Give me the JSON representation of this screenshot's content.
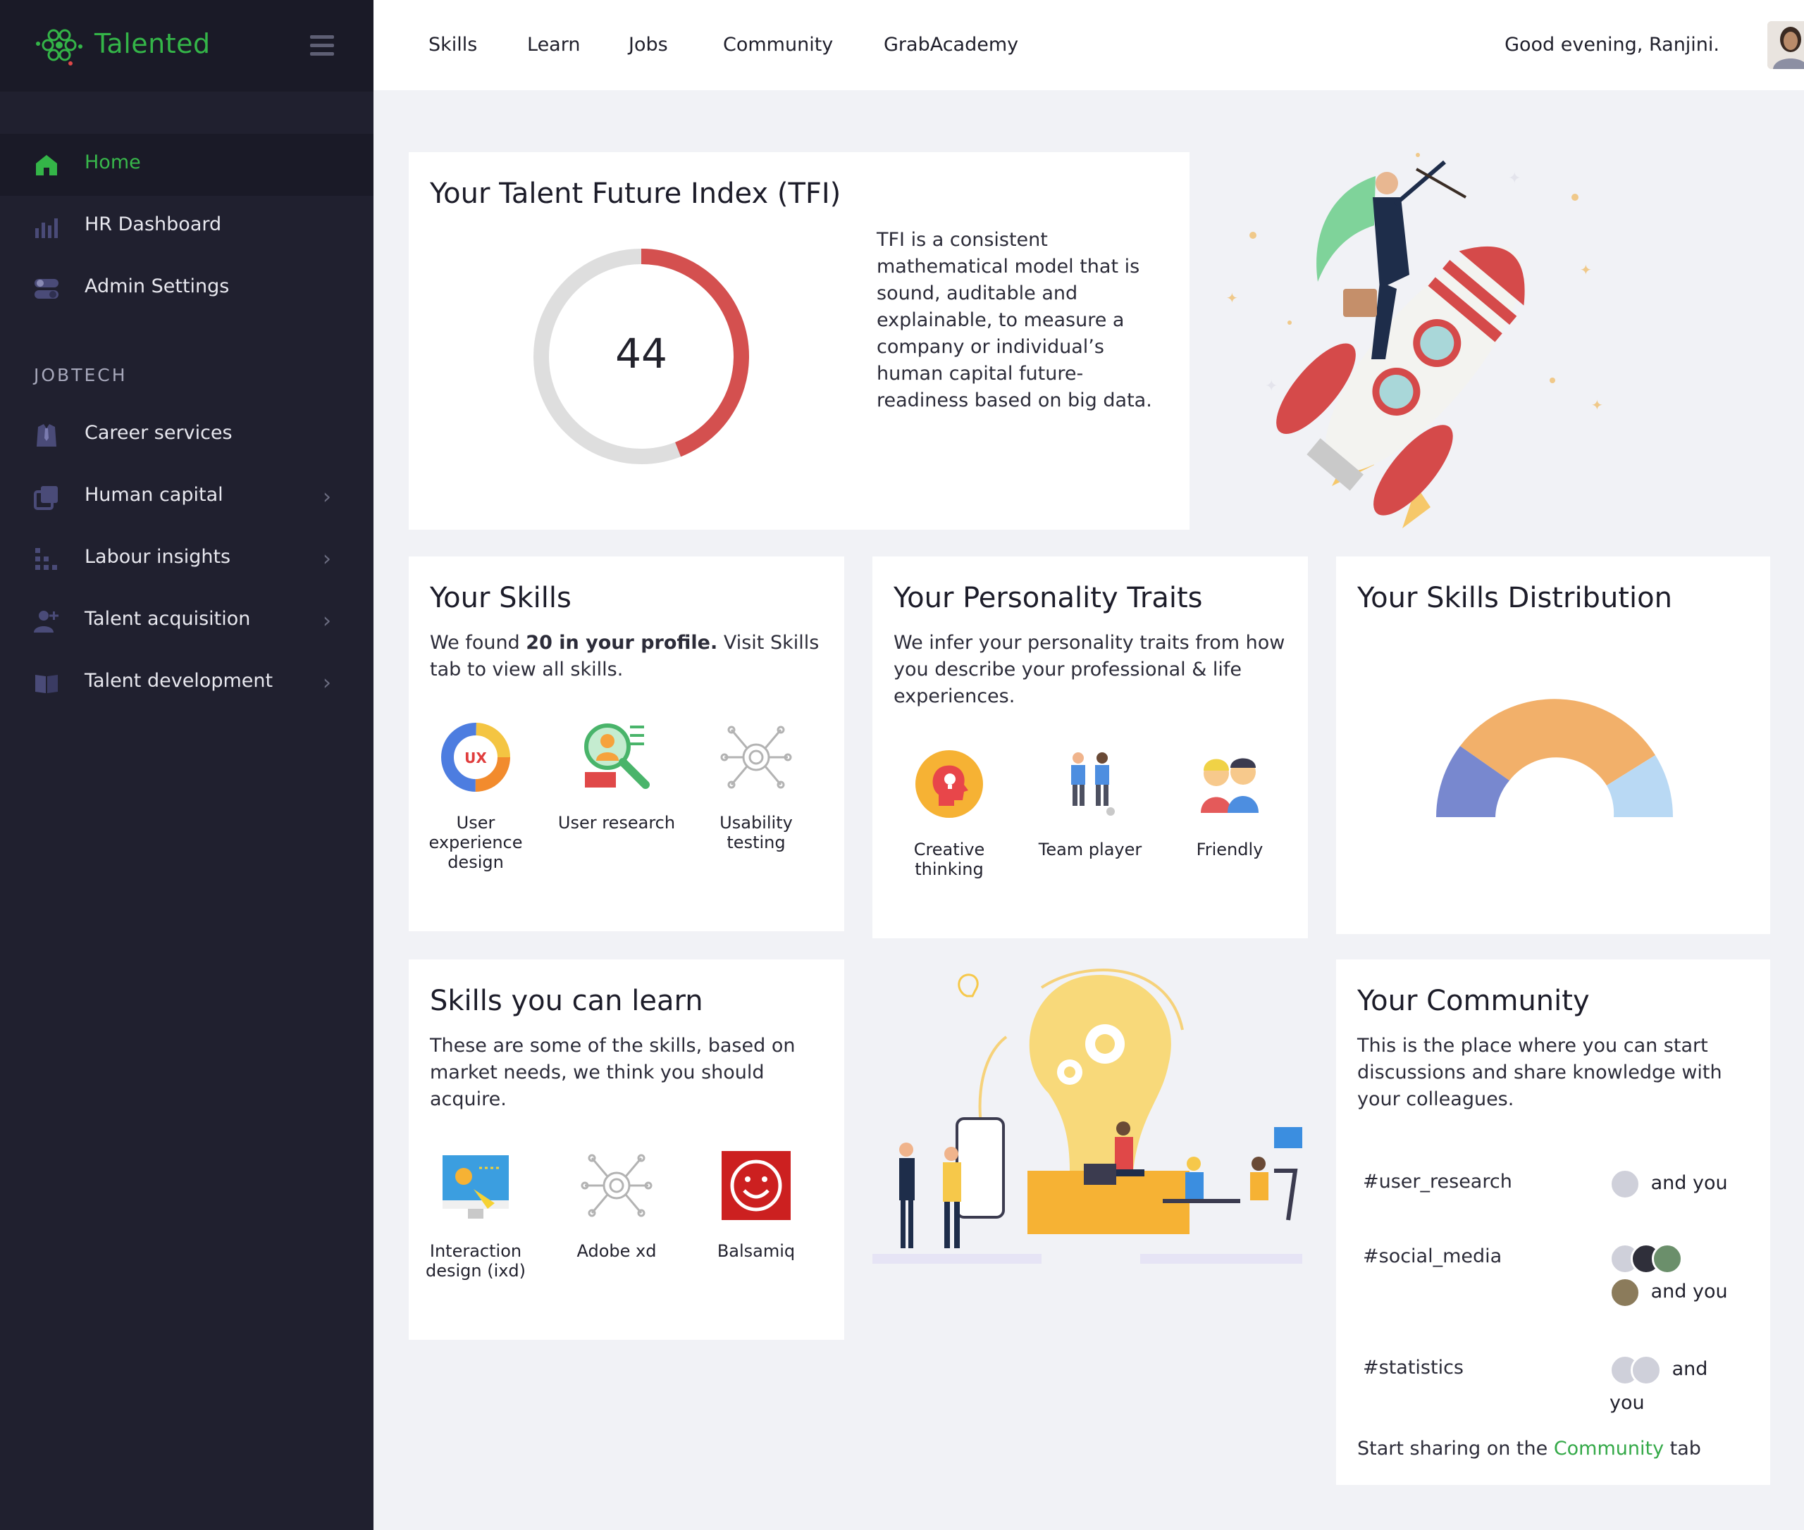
{
  "app": {
    "name": "Talented"
  },
  "sidebar": {
    "items": [
      {
        "label": "Home"
      },
      {
        "label": "HR Dashboard"
      },
      {
        "label": "Admin Settings"
      }
    ],
    "section_label": "JOBTECH",
    "jobtech_items": [
      {
        "label": "Career services"
      },
      {
        "label": "Human capital"
      },
      {
        "label": "Labour insights"
      },
      {
        "label": "Talent acquisition"
      },
      {
        "label": "Talent development"
      }
    ]
  },
  "topnav": {
    "links": [
      "Skills",
      "Learn",
      "Jobs",
      "Community",
      "GrabAcademy"
    ],
    "greeting": "Good evening,  Ranjini."
  },
  "tfi": {
    "title": "Your Talent Future Index (TFI)",
    "value": "44",
    "progress_percent": 44,
    "description": "TFI is a consistent mathematical model that is sound, auditable and explainable, to measure a company or individual’s human capital future-readiness based on big data.",
    "colors": {
      "fill": "#d4504f",
      "track": "#dedede"
    }
  },
  "skills": {
    "title": "Your Skills",
    "desc_pre": "We found ",
    "desc_bold": "20 in your profile.",
    "desc_post": " Visit Skills tab to view all skills.",
    "items": [
      {
        "label": "User experience design",
        "icon": "ux-icon"
      },
      {
        "label": "User research",
        "icon": "magnifier-icon"
      },
      {
        "label": "Usability testing",
        "icon": "network-icon"
      }
    ]
  },
  "personality": {
    "title": "Your Personality Traits",
    "desc": "We infer your personality traits from how you describe your professional & life experiences.",
    "items": [
      {
        "label": "Creative thinking",
        "icon": "creative-head-icon"
      },
      {
        "label": "Team player",
        "icon": "team-icon"
      },
      {
        "label": "Friendly",
        "icon": "friends-icon"
      }
    ]
  },
  "distribution": {
    "title": "Your Skills Distribution",
    "colors": [
      "#7888cf",
      "#f2b06a",
      "#b9d9f4"
    ]
  },
  "learn": {
    "title": "Skills you can learn",
    "desc": "These are some of the skills, based on market needs, we think you should acquire.",
    "items": [
      {
        "label": "Interaction design (ixd)",
        "icon": "interaction-icon"
      },
      {
        "label": "Adobe xd",
        "icon": "network-icon"
      },
      {
        "label": "Balsamiq",
        "icon": "balsamiq-icon"
      }
    ]
  },
  "community": {
    "title": "Your Community",
    "desc": "This is the place where you can start discussions and share knowledge with your colleagues.",
    "tags": [
      {
        "tag": "#user_research",
        "who": "and you"
      },
      {
        "tag": "#social_media",
        "who": "and you"
      },
      {
        "tag": "#statistics",
        "who": "and you"
      }
    ],
    "footer_pre": "Start sharing on the ",
    "footer_link": "Community",
    "footer_post": " tab"
  },
  "colors": {
    "brand": "#34b548",
    "sidebar_bg": "#20202f",
    "page_bg": "#f1f2f6"
  }
}
